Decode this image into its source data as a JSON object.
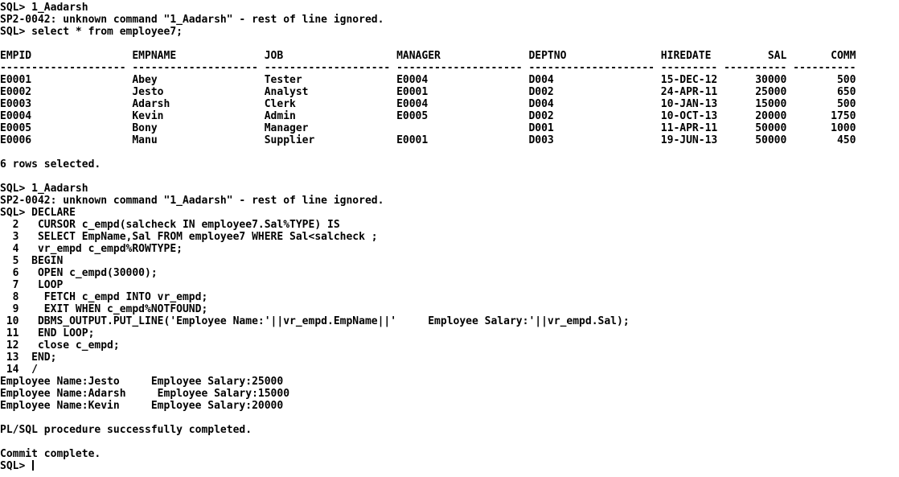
{
  "terminal": {
    "lines": [
      "SQL> 1_Aadarsh",
      "SP2-0042: unknown command \"1_Aadarsh\" - rest of line ignored.",
      "SQL> select * from employee7;",
      "",
      "EMPID                EMPNAME              JOB                  MANAGER              DEPTNO               HIREDATE         SAL       COMM",
      "-------------------- -------------------- -------------------- -------------------- -------------------- --------- ---------- ----------",
      "E0001                Abey                 Tester               E0004                D004                 15-DEC-12      30000        500",
      "E0002                Jesto                Analyst              E0001                D002                 24-APR-11      25000        650",
      "E0003                Adarsh               Clerk                E0004                D004                 10-JAN-13      15000        500",
      "E0004                Kevin                Admin                E0005                D002                 10-OCT-13      20000       1750",
      "E0005                Bony                 Manager                                   D001                 11-APR-11      50000       1000",
      "E0006                Manu                 Supplier             E0001                D003                 19-JUN-13      50000        450",
      "",
      "6 rows selected.",
      "",
      "SQL> 1_Aadarsh",
      "SP2-0042: unknown command \"1_Aadarsh\" - rest of line ignored.",
      "SQL> DECLARE",
      "  2   CURSOR c_empd(salcheck IN employee7.Sal%TYPE) IS",
      "  3   SELECT EmpName,Sal FROM employee7 WHERE Sal<salcheck ;",
      "  4   vr_empd c_empd%ROWTYPE;",
      "  5  BEGIN",
      "  6   OPEN c_empd(30000);",
      "  7   LOOP",
      "  8    FETCH c_empd INTO vr_empd;",
      "  9    EXIT WHEN c_empd%NOTFOUND;",
      " 10   DBMS_OUTPUT.PUT_LINE('Employee Name:'||vr_empd.EmpName||'     Employee Salary:'||vr_empd.Sal);",
      " 11   END LOOP;",
      " 12   close c_empd;",
      " 13  END;",
      " 14  /",
      "Employee Name:Jesto     Employee Salary:25000",
      "Employee Name:Adarsh     Employee Salary:15000",
      "Employee Name:Kevin     Employee Salary:20000",
      "",
      "PL/SQL procedure successfully completed.",
      "",
      "Commit complete.",
      "SQL> "
    ]
  }
}
